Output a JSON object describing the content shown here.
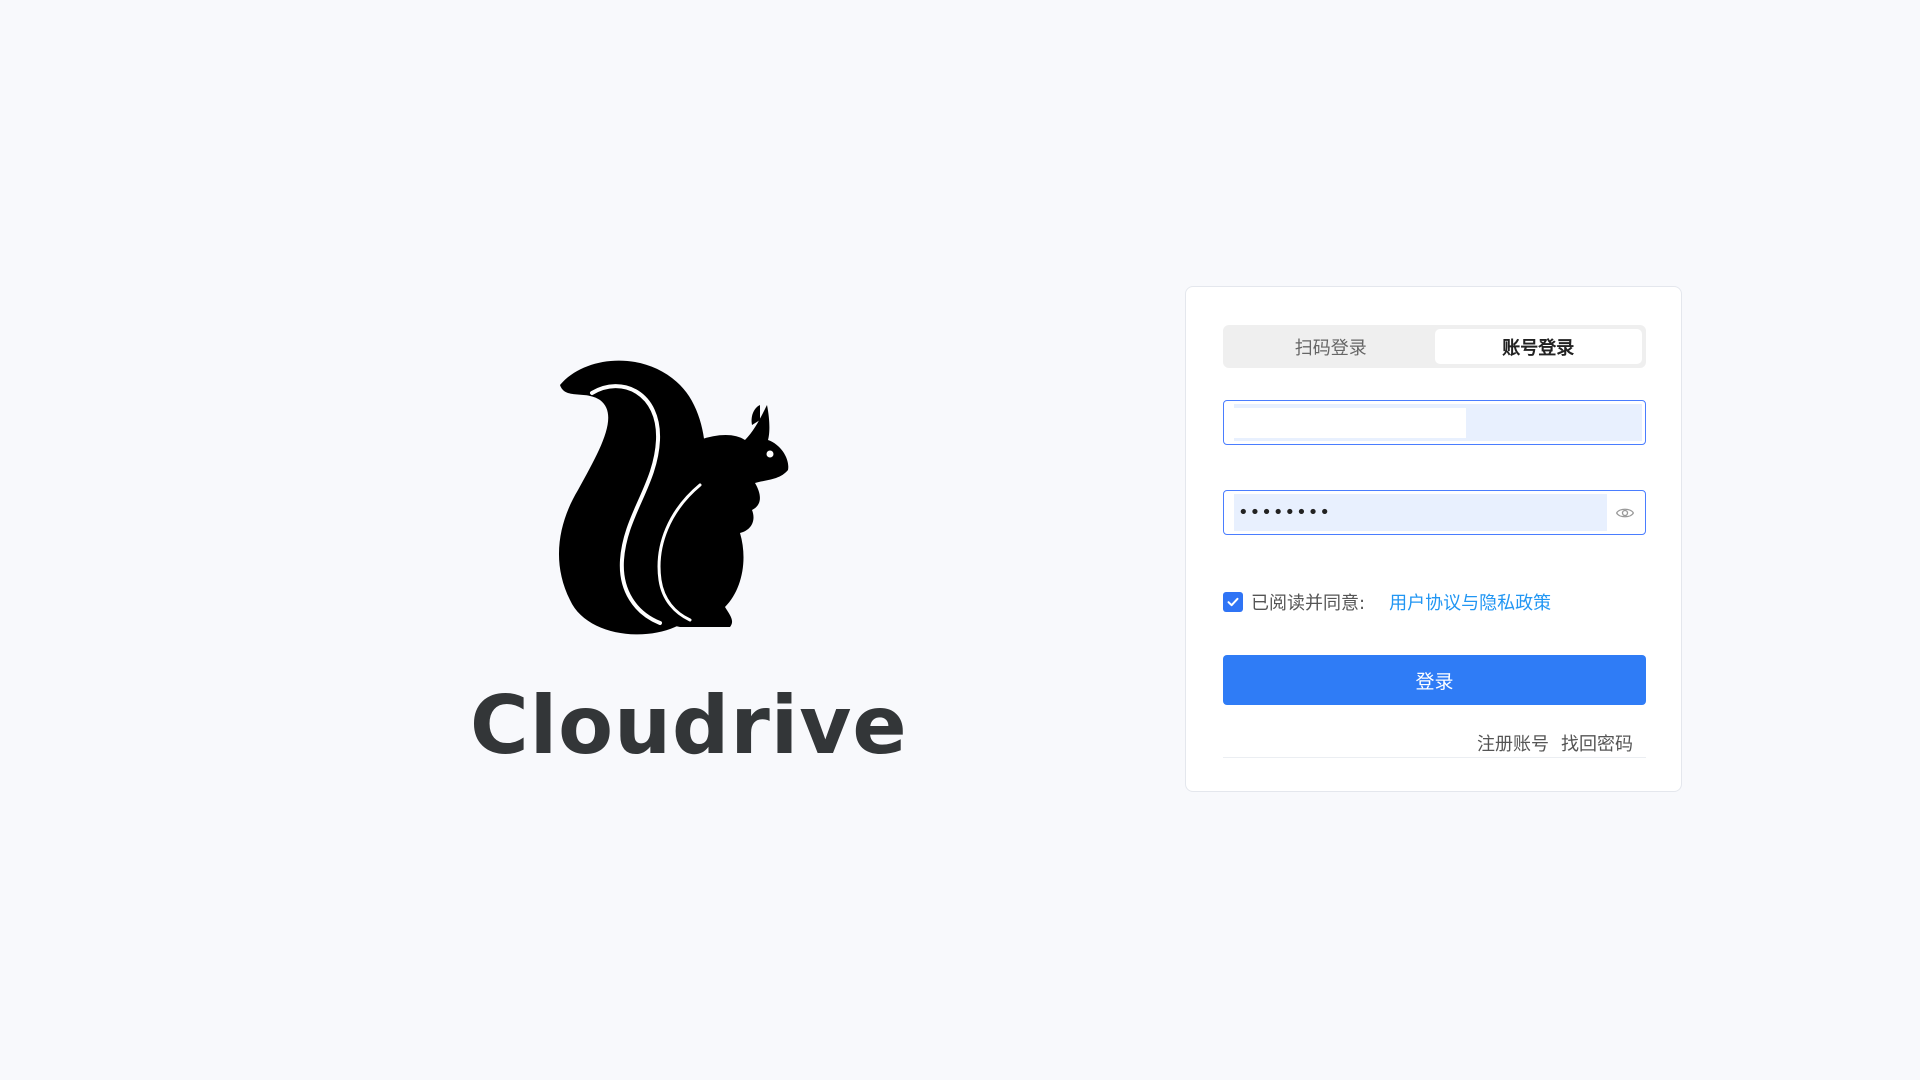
{
  "brand": {
    "name": "Cloudrive",
    "logo_icon": "squirrel-icon"
  },
  "login": {
    "tabs": [
      {
        "label": "扫码登录",
        "active": false
      },
      {
        "label": "账号登录",
        "active": true
      }
    ],
    "username": {
      "value": ""
    },
    "password": {
      "value": "••••••••",
      "toggle_icon": "eye-icon"
    },
    "agreement": {
      "checked": true,
      "text": "已阅读并同意:",
      "link": "用户协议与隐私政策"
    },
    "submit_label": "登录",
    "register_link": "注册账号",
    "forgot_link": "找回密码"
  },
  "colors": {
    "background": "#f8f9fc",
    "primary": "#2f7cf6",
    "link": "#2196f3",
    "autofill": "#e8f0fe"
  }
}
